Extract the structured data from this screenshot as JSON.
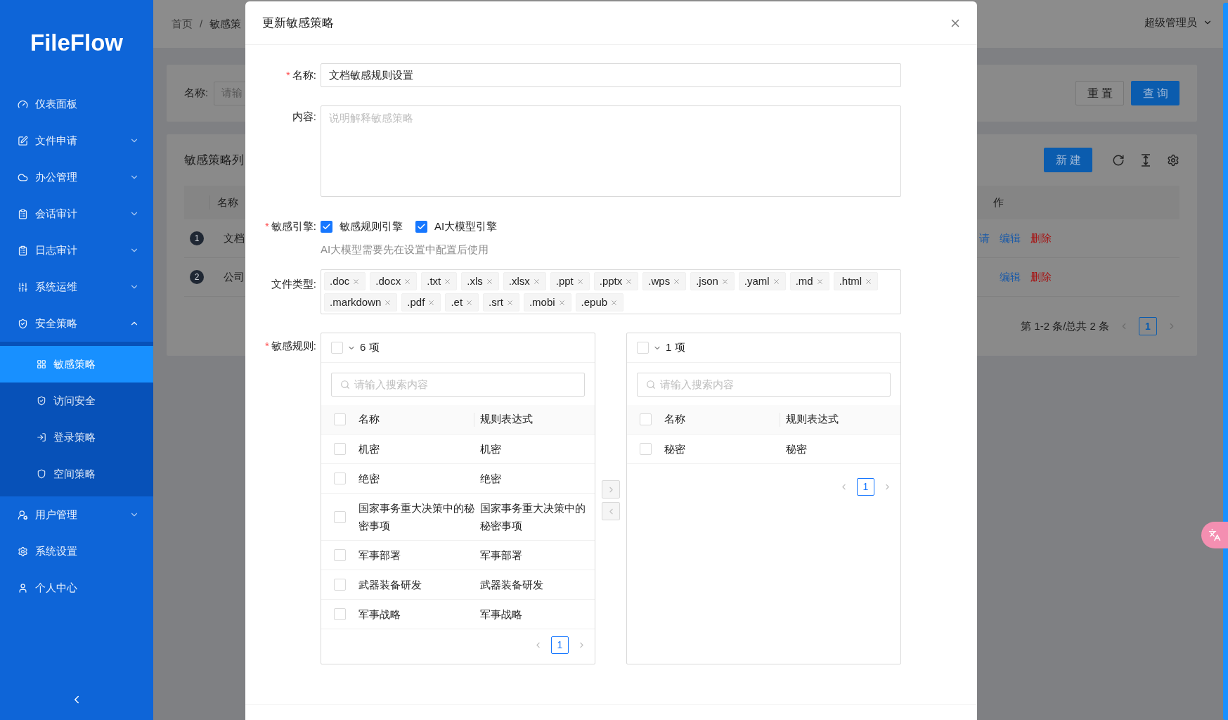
{
  "sidebar": {
    "logo": "FileFlow",
    "items": [
      {
        "label": "仪表面板"
      },
      {
        "label": "文件申请",
        "expanded": false
      },
      {
        "label": "办公管理",
        "expanded": false
      },
      {
        "label": "会话审计",
        "expanded": false
      },
      {
        "label": "日志审计",
        "expanded": false
      },
      {
        "label": "系统运维",
        "expanded": false
      },
      {
        "label": "安全策略",
        "expanded": true,
        "children": [
          {
            "label": "敏感策略",
            "selected": true
          },
          {
            "label": "访问安全",
            "selected": false
          },
          {
            "label": "登录策略",
            "selected": false
          },
          {
            "label": "空间策略",
            "selected": false
          }
        ]
      },
      {
        "label": "用户管理",
        "expanded": false
      },
      {
        "label": "系统设置"
      },
      {
        "label": "个人中心"
      }
    ]
  },
  "header": {
    "breadcrumb": [
      "首页",
      "敏感策"
    ],
    "separator": "/",
    "user": "超级管理员"
  },
  "search": {
    "label": "名称:",
    "placeholder": "请输",
    "buttons": [
      "重置",
      "查询"
    ]
  },
  "list": {
    "title": "敏感策略列",
    "new_button": "新建",
    "columns": [
      "名称",
      "作"
    ],
    "rows": [
      {
        "index": "1",
        "name": "文档",
        "actions": [
          "请",
          "编辑",
          "删除"
        ]
      },
      {
        "index": "2",
        "name": "公司",
        "actions": [
          "编辑",
          "删除"
        ]
      }
    ],
    "pagination": {
      "summary": "第 1-2 条/总共 2 条",
      "pages": [
        {
          "label": "1",
          "selected": true
        }
      ]
    }
  },
  "modal": {
    "title": "更新敏感策略",
    "name": {
      "required_mark": "*",
      "label": "名称:",
      "value": "文档敏感规则设置"
    },
    "content": {
      "label": "内容:",
      "placeholder": "说明解释敏感策略"
    },
    "engines": {
      "required_mark": "*",
      "label": "敏感引擎:",
      "options": [
        {
          "label": "敏感规则引擎",
          "checked": true
        },
        {
          "label": "AI大模型引擎",
          "checked": true
        }
      ],
      "hint": "AI大模型需要先在设置中配置后使用"
    },
    "file_types": {
      "label": "文件类型:",
      "tags": [
        ".doc",
        ".docx",
        ".txt",
        ".xls",
        ".xlsx",
        ".ppt",
        ".pptx",
        ".wps",
        ".json",
        ".yaml",
        ".md",
        ".html",
        ".markdown",
        ".pdf",
        ".et",
        ".srt",
        ".mobi",
        ".epub"
      ]
    },
    "rules": {
      "required_mark": "*",
      "label": "敏感规则:",
      "source": {
        "checked": false,
        "count": "6 项",
        "search_placeholder": "请输入搜索内容",
        "columns": [
          "名称",
          "规则表达式"
        ],
        "header_checked": false,
        "rows": [
          {
            "name": "机密",
            "expression": "机密",
            "checked": false
          },
          {
            "name": "绝密",
            "expression": "绝密",
            "checked": false
          },
          {
            "name": "国家事务重大决策中的秘密事项",
            "expression": "国家事务重大决策中的秘密事项",
            "checked": false
          },
          {
            "name": "军事部署",
            "expression": "军事部署",
            "checked": false
          },
          {
            "name": "武器装备研发",
            "expression": "武器装备研发",
            "checked": false
          },
          {
            "name": "军事战略",
            "expression": "军事战略",
            "checked": false
          }
        ],
        "pages": [
          {
            "label": "1",
            "selected": true
          }
        ]
      },
      "target": {
        "checked": false,
        "count": "1 项",
        "search_placeholder": "请输入搜索内容",
        "columns": [
          "名称",
          "规则表达式"
        ],
        "header_checked": false,
        "rows": [
          {
            "name": "秘密",
            "expression": "秘密",
            "checked": false
          }
        ],
        "pages": [
          {
            "label": "1",
            "selected": true
          }
        ]
      }
    }
  }
}
